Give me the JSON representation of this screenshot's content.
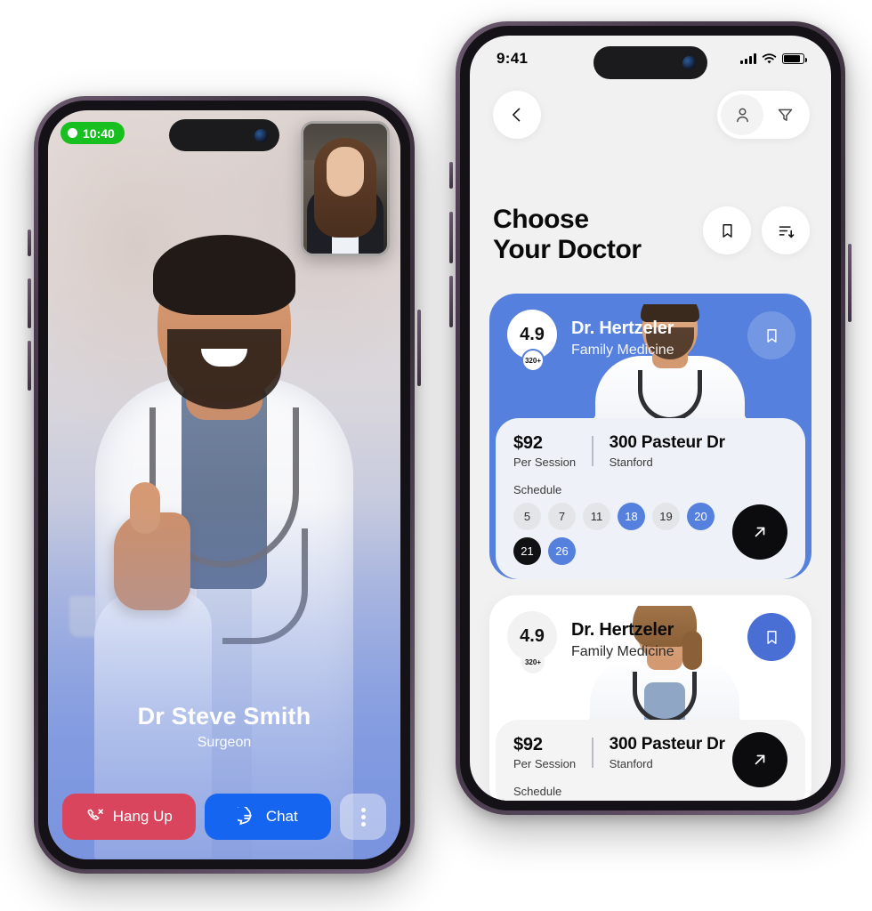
{
  "call_screen": {
    "timer": "10:40",
    "timer_icon": "record-dot-icon",
    "doctor_name": "Dr Steve Smith",
    "doctor_role": "Surgeon",
    "pip_label": "self-view",
    "buttons": {
      "hangup_label": "Hang Up",
      "hangup_icon": "phone-hangup-icon",
      "hangup_color": "#d9455c",
      "chat_label": "Chat",
      "chat_icon": "chat-bubble-icon",
      "chat_color": "#1565f0",
      "more_icon": "more-vertical-icon"
    }
  },
  "doctor_list_screen": {
    "statusbar": {
      "time": "9:41",
      "signal_icon": "cellular-signal-icon",
      "wifi_icon": "wifi-icon",
      "battery_icon": "battery-icon"
    },
    "topnav": {
      "back_icon": "chevron-left-icon",
      "profile_icon": "person-icon",
      "filter_icon": "funnel-filter-icon"
    },
    "title_line1": "Choose",
    "title_line2": "Your Doctor",
    "head_actions": {
      "bookmark_icon": "bookmark-icon",
      "sort_icon": "sort-descending-icon"
    },
    "accent_blue": "#5680de",
    "cards": [
      {
        "theme": "blue",
        "rating": "4.9",
        "rating_count": "320+",
        "name": "Dr. Hertzeler",
        "specialty": "Family Medicine",
        "bookmarked": false,
        "bookmark_icon": "bookmark-icon",
        "price": "$92",
        "price_sub": "Per Session",
        "address": "300 Pasteur Dr",
        "address_sub": "Stanford",
        "schedule_label": "Schedule",
        "days": [
          {
            "d": "5",
            "state": "grey"
          },
          {
            "d": "7",
            "state": "grey"
          },
          {
            "d": "11",
            "state": "grey"
          },
          {
            "d": "18",
            "state": "blue"
          },
          {
            "d": "19",
            "state": "grey"
          },
          {
            "d": "20",
            "state": "blue"
          },
          {
            "d": "21",
            "state": "dark"
          },
          {
            "d": "26",
            "state": "blue"
          }
        ],
        "go_icon": "arrow-up-right-icon",
        "portrait": "male-doctor-photo"
      },
      {
        "theme": "white",
        "rating": "4.9",
        "rating_count": "320+",
        "name": "Dr. Hertzeler",
        "specialty": "Family Medicine",
        "bookmarked": true,
        "bookmark_icon": "bookmark-icon",
        "price": "$92",
        "price_sub": "Per Session",
        "address": "300 Pasteur Dr",
        "address_sub": "Stanford",
        "schedule_label": "Schedule",
        "days": [],
        "go_icon": "arrow-up-right-icon",
        "portrait": "female-doctor-photo"
      }
    ]
  }
}
